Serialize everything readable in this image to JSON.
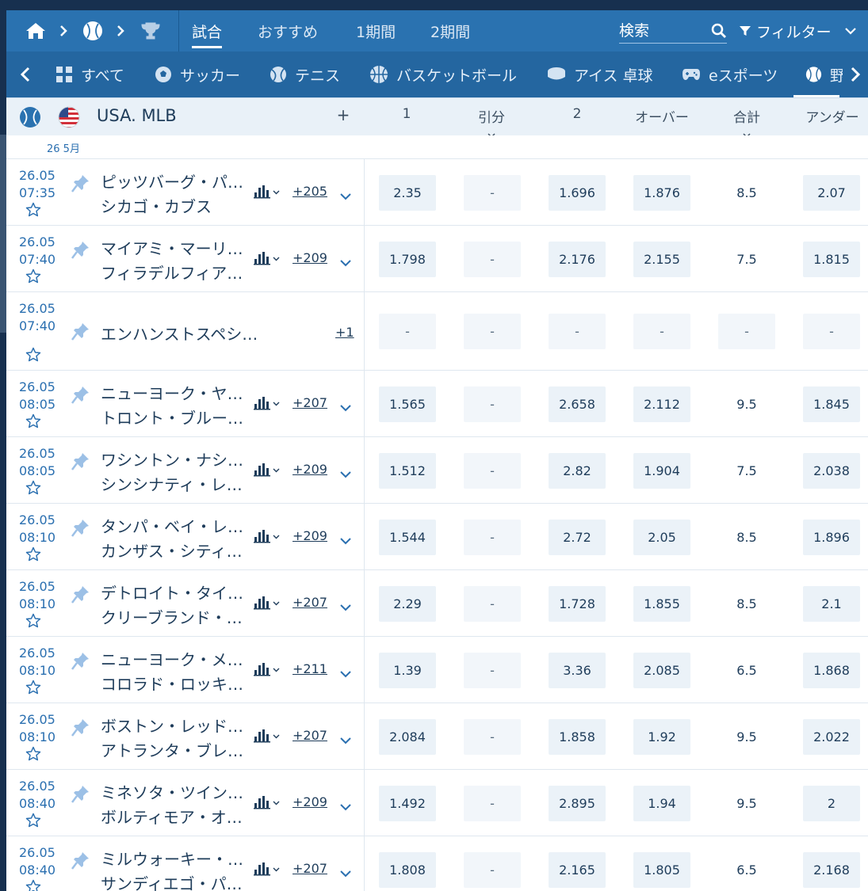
{
  "topbar": {
    "tabs": [
      {
        "label": "試合",
        "active": true
      },
      {
        "label": "おすすめ",
        "active": false
      },
      {
        "label": "1期間",
        "active": false
      },
      {
        "label": "2期間",
        "active": false
      }
    ],
    "search_placeholder": "検索",
    "filter_label": "フィルター"
  },
  "sports": [
    {
      "label": "すべて",
      "icon": "grid-icon"
    },
    {
      "label": "サッカー",
      "icon": "soccer-ball-icon"
    },
    {
      "label": "テニス",
      "icon": "tennis-ball-icon"
    },
    {
      "label": "バスケットボール",
      "icon": "basketball-icon"
    },
    {
      "label": "アイス 卓球",
      "icon": "hockey-puck-icon"
    },
    {
      "label": "eスポーツ",
      "icon": "gamepad-icon"
    },
    {
      "label": "野",
      "icon": "baseball-icon"
    }
  ],
  "league": {
    "title": "USA. MLB",
    "plus": "+",
    "headers": [
      "1",
      "引分",
      "2",
      "オーバー",
      "合計",
      "アンダー"
    ]
  },
  "date_label": "26 5月",
  "matches": [
    {
      "date": "26.05",
      "time": "07:35",
      "team1": "ピッツバーグ・パ…",
      "team2": "シカゴ・カブス",
      "more": "+205",
      "odds": [
        "2.35",
        "-",
        "1.696",
        "1.876",
        "8.5",
        "2.07"
      ]
    },
    {
      "date": "26.05",
      "time": "07:40",
      "team1": "マイアミ・マーリ…",
      "team2": "フィラデルフィア…",
      "more": "+209",
      "odds": [
        "1.798",
        "-",
        "2.176",
        "2.155",
        "7.5",
        "1.815"
      ]
    },
    {
      "date": "26.05",
      "time": "07:40",
      "team1": "エンハンストスペシ…",
      "team2": "",
      "more": "+1",
      "odds": [
        "-",
        "-",
        "-",
        "-",
        "-",
        "-"
      ],
      "special": true
    },
    {
      "date": "26.05",
      "time": "08:05",
      "team1": "ニューヨーク・ヤ…",
      "team2": "トロント・ブルー…",
      "more": "+207",
      "odds": [
        "1.565",
        "-",
        "2.658",
        "2.112",
        "9.5",
        "1.845"
      ]
    },
    {
      "date": "26.05",
      "time": "08:05",
      "team1": "ワシントン・ナシ…",
      "team2": "シンシナティ・レ…",
      "more": "+209",
      "odds": [
        "1.512",
        "-",
        "2.82",
        "1.904",
        "7.5",
        "2.038"
      ]
    },
    {
      "date": "26.05",
      "time": "08:10",
      "team1": "タンパ・ベイ・レ…",
      "team2": "カンザス・シティ…",
      "more": "+209",
      "odds": [
        "1.544",
        "-",
        "2.72",
        "2.05",
        "8.5",
        "1.896"
      ]
    },
    {
      "date": "26.05",
      "time": "08:10",
      "team1": "デトロイト・タイ…",
      "team2": "クリーブランド・…",
      "more": "+207",
      "odds": [
        "2.29",
        "-",
        "1.728",
        "1.855",
        "8.5",
        "2.1"
      ]
    },
    {
      "date": "26.05",
      "time": "08:10",
      "team1": "ニューヨーク・メ…",
      "team2": "コロラド・ロッキ…",
      "more": "+211",
      "odds": [
        "1.39",
        "-",
        "3.36",
        "2.085",
        "6.5",
        "1.868"
      ]
    },
    {
      "date": "26.05",
      "time": "08:10",
      "team1": "ボストン・レッド…",
      "team2": "アトランタ・ブレ…",
      "more": "+207",
      "odds": [
        "2.084",
        "-",
        "1.858",
        "1.92",
        "9.5",
        "2.022"
      ]
    },
    {
      "date": "26.05",
      "time": "08:40",
      "team1": "ミネソタ・ツイン…",
      "team2": "ボルティモア・オ…",
      "more": "+209",
      "odds": [
        "1.492",
        "-",
        "2.895",
        "1.94",
        "9.5",
        "2"
      ]
    },
    {
      "date": "26.05",
      "time": "08:40",
      "team1": "ミルウォーキー・…",
      "team2": "サンディエゴ・パ…",
      "more": "+207",
      "odds": [
        "1.808",
        "-",
        "2.165",
        "1.805",
        "6.5",
        "2.168"
      ]
    }
  ]
}
